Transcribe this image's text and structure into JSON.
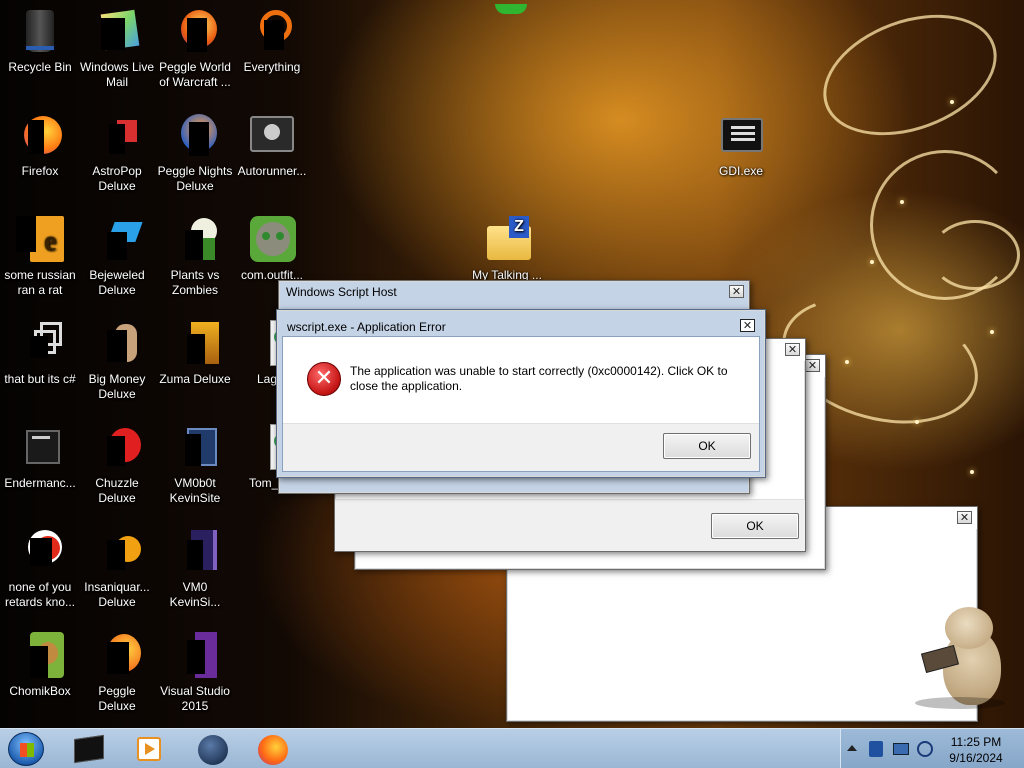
{
  "desktop_icons": [
    {
      "label": "Recycle Bin",
      "icon": "recycle-bin-icon"
    },
    {
      "label": "Windows Live Mail",
      "icon": "windows-live-mail-icon"
    },
    {
      "label": "Peggle World of Warcraft ...",
      "icon": "peggle-wow-icon"
    },
    {
      "label": "Everything",
      "icon": "everything-search-icon"
    },
    {
      "label": "Firefox",
      "icon": "firefox-icon"
    },
    {
      "label": "AstroPop Deluxe",
      "icon": "astropop-icon"
    },
    {
      "label": "Peggle Nights Deluxe",
      "icon": "peggle-nights-icon"
    },
    {
      "label": "Autorunner...",
      "icon": "autorunner-icon"
    },
    {
      "label": "some russian ran a rat",
      "icon": "russian-rat-icon"
    },
    {
      "label": "Bejeweled Deluxe",
      "icon": "bejeweled-icon"
    },
    {
      "label": "Plants vs Zombies",
      "icon": "plants-vs-zombies-icon"
    },
    {
      "label": "com.outfit...",
      "icon": "talking-tom-icon"
    },
    {
      "label": "that but its c#",
      "icon": "shortcut-stack-icon"
    },
    {
      "label": "Big Money Deluxe",
      "icon": "big-money-icon"
    },
    {
      "label": "Zuma Deluxe",
      "icon": "zuma-icon"
    },
    {
      "label": "Lag...",
      "icon": "script-file-icon"
    },
    {
      "label": "Endermanc...",
      "icon": "endermanch-icon"
    },
    {
      "label": "Chuzzle Deluxe",
      "icon": "chuzzle-icon"
    },
    {
      "label": "VM0b0t KevinSite",
      "icon": "vm-folder-icon"
    },
    {
      "label": "Tom_1...",
      "icon": "script-file-icon"
    },
    {
      "label": "none of you retards kno...",
      "icon": "ruby-icon"
    },
    {
      "label": "Insaniquar... Deluxe",
      "icon": "insaniquarium-icon"
    },
    {
      "label": "VM0 KevinSi...",
      "icon": "vm-folder-icon"
    },
    {
      "label": "ChomikBox",
      "icon": "chomikbox-icon"
    },
    {
      "label": "Peggle Deluxe",
      "icon": "peggle-icon"
    },
    {
      "label": "Visual Studio 2015",
      "icon": "visual-studio-icon"
    },
    {
      "label": "GDI.exe",
      "icon": "gdi-exe-icon"
    },
    {
      "label": "My Talking ...",
      "icon": "zip-folder-icon"
    }
  ],
  "dialogs": {
    "script_host": {
      "title": "Windows Script Host"
    },
    "app_error": {
      "title": "wscript.exe - Application Error",
      "message": "The application was unable to start correctly (0xc0000142). Click OK to close the application.",
      "ok_label": "OK",
      "icon": "error-icon"
    },
    "back_dialog": {
      "ok_label": "OK"
    }
  },
  "taskbar": {
    "start": "start-orb-icon",
    "pinned": [
      "terminal-icon",
      "media-player-icon",
      "browser-globe-icon",
      "firefox-icon"
    ],
    "tray": {
      "time": "11:25 PM",
      "date": "9/16/2024"
    }
  },
  "colors": {
    "error_red": "#d22020",
    "taskbar_blue": "#a9c3de",
    "title_blue": "#c9d7e8"
  }
}
